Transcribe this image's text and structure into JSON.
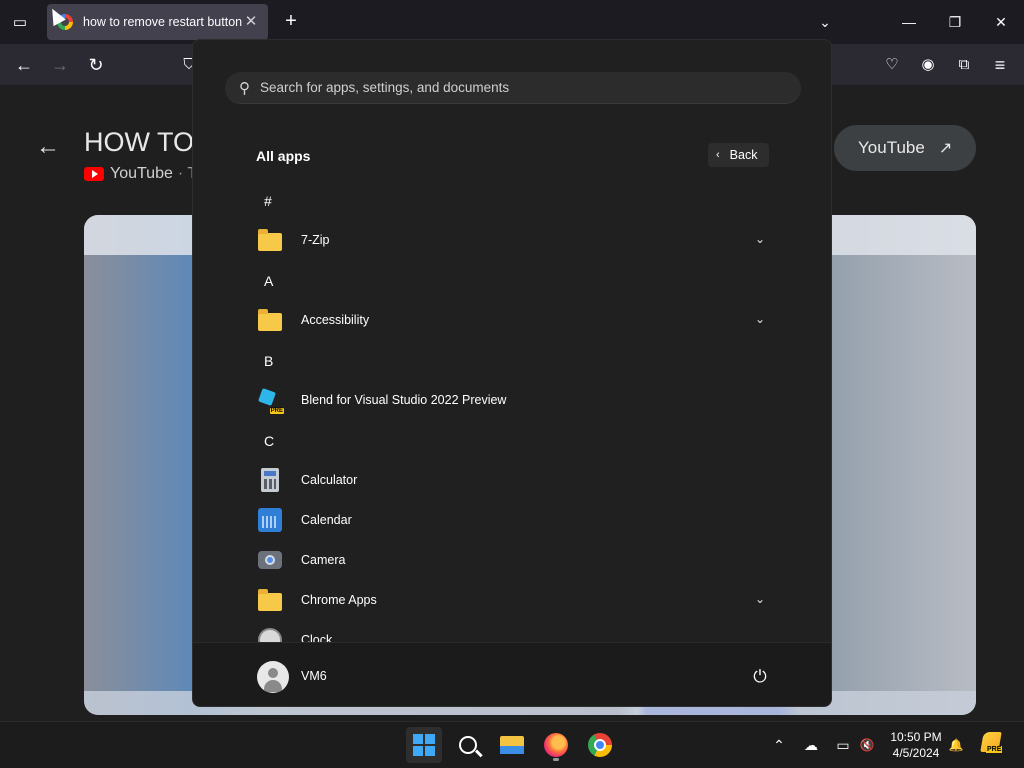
{
  "browser": {
    "tab_title": "how to remove restart button",
    "tab_close": "✕",
    "new_tab": "+",
    "tab_list_icon": "▭",
    "window_controls": {
      "chevron": "⌄",
      "minimize": "—",
      "restore": "❐",
      "close": "✕"
    },
    "nav": {
      "back": "←",
      "forward": "→",
      "reload": "↻",
      "shield": "⛉",
      "pocket": "♡",
      "account": "◉",
      "extensions": "⧉",
      "menu": "≡"
    }
  },
  "page": {
    "back": "←",
    "title": "HOW TO",
    "source": "YouTube",
    "source_sep": "· T",
    "youtube_button": "YouTube",
    "external_icon": "↗"
  },
  "start_menu": {
    "search_placeholder": "Search for apps, settings, and documents",
    "search_icon": "search-icon",
    "all_apps_title": "All apps",
    "back_label": "Back",
    "back_chevron": "‹",
    "letters": [
      "#",
      "A",
      "B",
      "C"
    ],
    "apps": [
      {
        "label": "7-Zip",
        "icon": "folder-icon",
        "expandable": true
      },
      {
        "label": "Accessibility",
        "icon": "folder-icon",
        "expandable": true
      },
      {
        "label": "Blend for Visual Studio 2022 Preview",
        "icon": "blend-icon",
        "expandable": false
      },
      {
        "label": "Calculator",
        "icon": "calculator-icon",
        "expandable": false
      },
      {
        "label": "Calendar",
        "icon": "calendar-icon",
        "expandable": false
      },
      {
        "label": "Camera",
        "icon": "camera-icon",
        "expandable": false
      },
      {
        "label": "Chrome Apps",
        "icon": "folder-icon",
        "expandable": true
      },
      {
        "label": "Clock",
        "icon": "clock-icon",
        "expandable": false
      }
    ],
    "expand_glyph": "⌄",
    "user_name": "VM6",
    "power_icon": "⏻",
    "blend_badge": "PRE"
  },
  "taskbar": {
    "time": "10:50 PM",
    "date": "4/5/2024",
    "tray": {
      "chevron": "⌃",
      "cloud": "☁",
      "network": "▭",
      "volume": "🔇",
      "bell": "🔔"
    },
    "badge": "PRE"
  },
  "colors": {
    "start_bg": "#202020",
    "accent": "#3fa9f5",
    "folder": "#f7c948"
  }
}
